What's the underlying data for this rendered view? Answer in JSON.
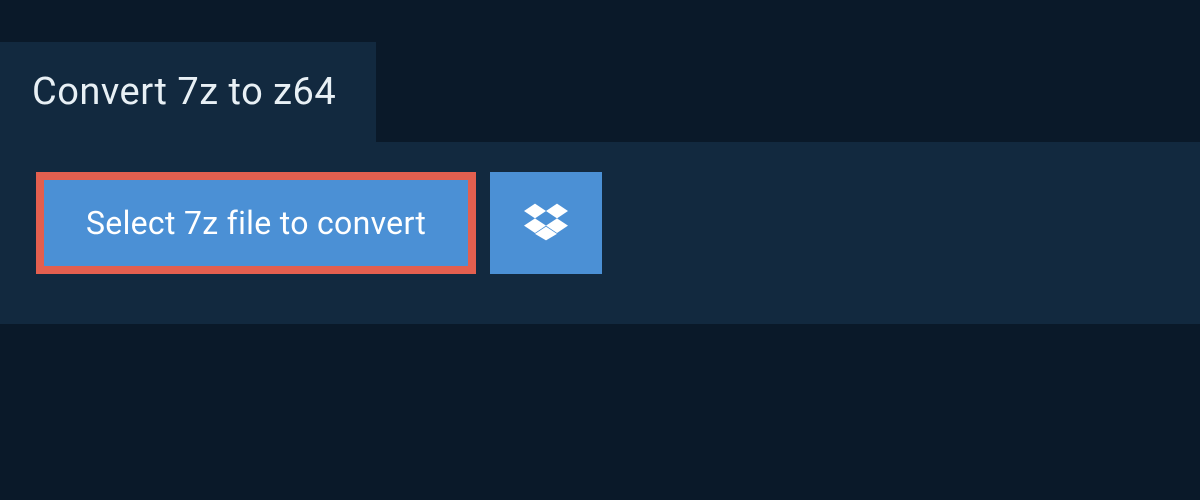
{
  "header": {
    "title": "Convert 7z to z64"
  },
  "main": {
    "select_button_label": "Select 7z file to convert"
  }
}
